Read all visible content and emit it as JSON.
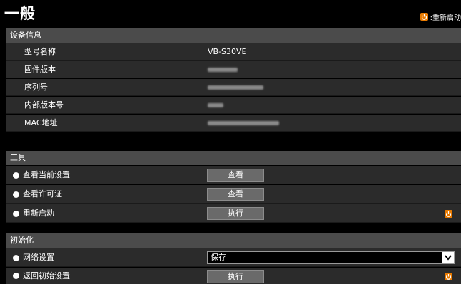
{
  "header": {
    "title": "一般",
    "restart_legend": ":重新启动",
    "accent_color": "#e87a00"
  },
  "device_info": {
    "section_title": "设备信息",
    "rows": [
      {
        "label": "型号名称",
        "value": "VB-S30VE"
      },
      {
        "label": "固件版本",
        "value": ""
      },
      {
        "label": "序列号",
        "value": ""
      },
      {
        "label": "内部版本号",
        "value": ""
      },
      {
        "label": "MAC地址",
        "value": ""
      }
    ]
  },
  "tools": {
    "section_title": "工具",
    "rows": [
      {
        "label": "查看当前设置",
        "button": "查看"
      },
      {
        "label": "查看许可证",
        "button": "查看"
      },
      {
        "label": "重新启动",
        "button": "执行"
      }
    ]
  },
  "init": {
    "section_title": "初始化",
    "rows": [
      {
        "label": "网络设置",
        "select_value": "保存"
      },
      {
        "label": "返回初始设置",
        "button": "执行"
      }
    ]
  }
}
